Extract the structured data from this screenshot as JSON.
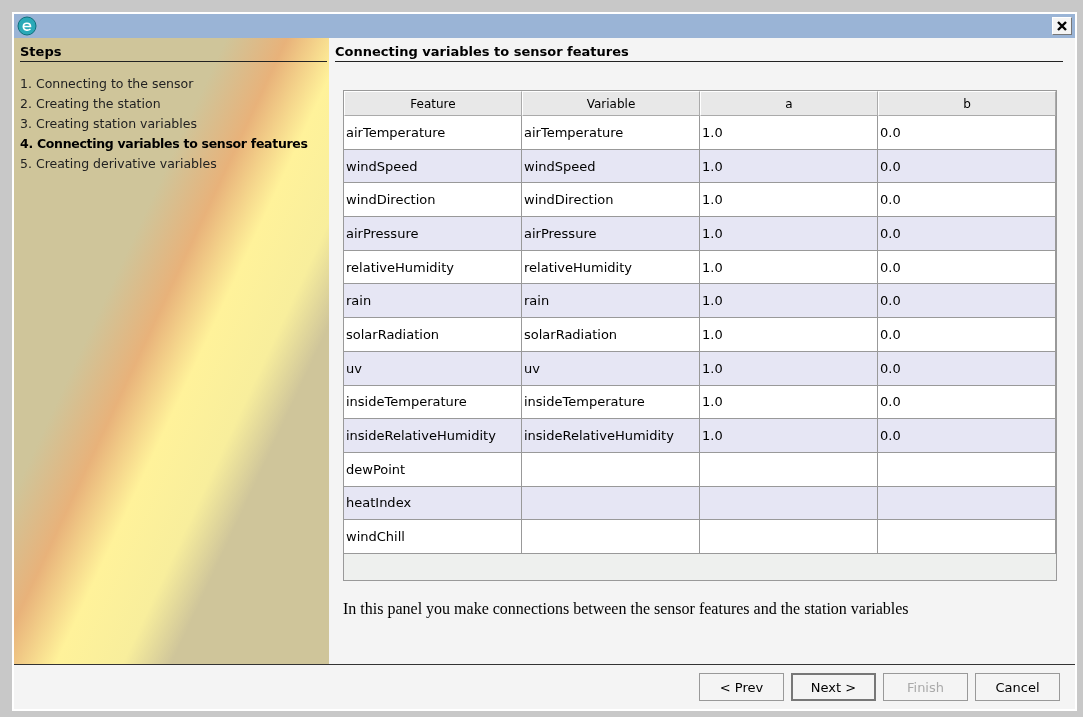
{
  "steps_panel": {
    "title": "Steps",
    "items": [
      {
        "label": "1. Connecting to the sensor",
        "selected": false
      },
      {
        "label": "2. Creating the station",
        "selected": false
      },
      {
        "label": "3. Creating station variables",
        "selected": false
      },
      {
        "label": "4. Connecting variables to sensor features",
        "selected": true
      },
      {
        "label": "5. Creating derivative variables",
        "selected": false
      }
    ]
  },
  "content": {
    "title": "Connecting variables to sensor features",
    "table": {
      "columns": [
        "Feature",
        "Variable",
        "a",
        "b"
      ],
      "rows": [
        [
          "airTemperature",
          "airTemperature",
          "1.0",
          "0.0"
        ],
        [
          "windSpeed",
          "windSpeed",
          "1.0",
          "0.0"
        ],
        [
          "windDirection",
          "windDirection",
          "1.0",
          "0.0"
        ],
        [
          "airPressure",
          "airPressure",
          "1.0",
          "0.0"
        ],
        [
          "relativeHumidity",
          "relativeHumidity",
          "1.0",
          "0.0"
        ],
        [
          "rain",
          "rain",
          "1.0",
          "0.0"
        ],
        [
          "solarRadiation",
          "solarRadiation",
          "1.0",
          "0.0"
        ],
        [
          "uv",
          "uv",
          "1.0",
          "0.0"
        ],
        [
          "insideTemperature",
          "insideTemperature",
          "1.0",
          "0.0"
        ],
        [
          "insideRelativeHumidity",
          "insideRelativeHumidity",
          "1.0",
          "0.0"
        ],
        [
          "dewPoint"
        ],
        [
          "heatIndex"
        ],
        [
          "windChill"
        ]
      ]
    },
    "description": "In this panel you make connections between the sensor features and the station variables"
  },
  "buttons": [
    {
      "label": "< Prev",
      "disabled": false
    },
    {
      "label": "Next >",
      "disabled": false
    },
    {
      "label": "Finish",
      "disabled": true
    },
    {
      "label": "Cancel",
      "disabled": false
    }
  ]
}
